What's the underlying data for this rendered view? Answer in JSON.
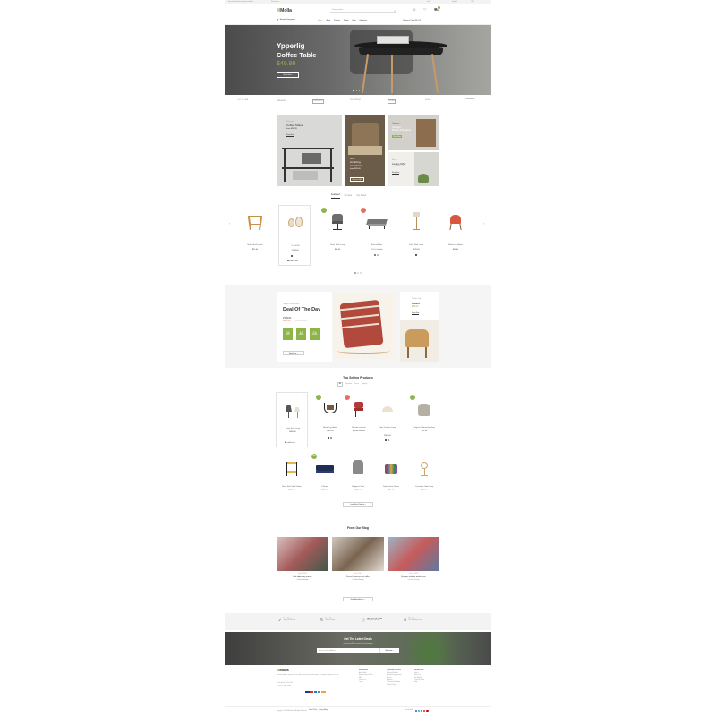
{
  "topbar": {
    "left_text": "Special collection already available.",
    "left_link": "Read more ...",
    "links": [
      "Links",
      "English",
      "USD"
    ]
  },
  "header": {
    "logo_prefix": "M",
    "logo_main": "Molla",
    "search_placeholder": "Search product ...",
    "icons": [
      "user-icon",
      "heart-icon",
      "cart-icon"
    ],
    "cart_count": "2",
    "cart_label": "Shopping Cart",
    "cart_total": "$164.00"
  },
  "nav": {
    "categories_label": "Browse Categories",
    "items": [
      "Home",
      "Shop",
      "Product",
      "Pages",
      "Blog",
      "Elements"
    ],
    "active_index": 0,
    "promo": "Clearance Up to 30% Off"
  },
  "hero": {
    "title_line1": "Ypperlig",
    "title_line2": "Coffee Table",
    "price": "$49.99",
    "button": "Shop Now",
    "dots": 3,
    "active_dot": 0
  },
  "brands": [
    "OLIVEIRA",
    "Sheaves",
    "BRENNER",
    "mockup",
    "ATLAS",
    "NORD",
    "THEBRIDE"
  ],
  "banners": [
    {
      "kicker": "Clearance",
      "title_line1": "Coffee Tables",
      "title_line2": "from $99.99",
      "button": "Shop Now"
    },
    {
      "kicker": "New in",
      "title_line1": "Amazing",
      "title_line2": "Armchairs",
      "subtitle": "from $39.00",
      "button": "Discover Now"
    },
    {
      "kicker": "Clearance",
      "title_line1": "Storage",
      "title_line2": "Boxes & Baskets",
      "button": "Shop Now"
    },
    {
      "kicker": "New in",
      "title_line1": "Lamps Offer",
      "title_line2": "up to 30% off",
      "button": "Shop Now"
    }
  ],
  "tabs": {
    "items": [
      "Featured",
      "On Sale",
      "Top Rated"
    ],
    "active_index": 0
  },
  "featured": {
    "products": [
      {
        "name": "Butler Stool Ladder",
        "price": "$25.00",
        "badge": "",
        "icon": "stool-icon"
      },
      {
        "name": "Octo 4240",
        "price": "$746.00",
        "badge": "",
        "icon": "pendant-lamp-icon",
        "action": "add to cart"
      },
      {
        "name": "Petite Table Lamp",
        "price": "$99.00",
        "badge": "Top",
        "icon": "chair-icon"
      },
      {
        "name": "Sofa with Arm",
        "price": "$33.00",
        "old_price": "$40.00",
        "badge": "Sale",
        "icon": "sofa-icon"
      },
      {
        "name": "Petite Table Lamp",
        "price": "$675.00",
        "badge": "",
        "icon": "floor-lamp-icon"
      },
      {
        "name": "Madra Log Holder",
        "price": "$40.00",
        "badge": "",
        "icon": "armchair-icon"
      }
    ],
    "dots": 3
  },
  "deal": {
    "kicker": "Today's Deal and more",
    "title": "Deal Of The Day",
    "product": "POÄNG",
    "price": "$249.00",
    "old_price": "Was $339.00",
    "countdown": [
      {
        "value": "06",
        "label": "hours"
      },
      {
        "value": "16",
        "label": "minutes"
      },
      {
        "value": "24",
        "label": "seconds"
      }
    ],
    "button": "Shop Now",
    "side_kicker": "The Best Choice",
    "side_title": "AGEN",
    "side_price": "$49.00",
    "side_button": "Shop Now"
  },
  "topselling": {
    "title": "Top Selling Products",
    "tabs": [
      "All",
      "Furniture",
      "Decor",
      "Lighting"
    ],
    "active_tab": 0,
    "row1": [
      {
        "name": "Petite Table Lamp",
        "price": "$400.00",
        "badge": "",
        "icon": "table-lamp-icon",
        "action": "add to cart"
      },
      {
        "name": "Madra Log Holder",
        "price": "$401.00",
        "badge": "Top",
        "icon": "log-holder-icon"
      },
      {
        "name": "Wooden armchair",
        "price": "$90.00",
        "old_price": "$100.00",
        "badge": "Sale",
        "icon": "dining-chair-icon"
      },
      {
        "name": "Lime Cordless Lamp",
        "price": "$351.00",
        "badge": "",
        "icon": "pendant-lamp-icon"
      },
      {
        "name": "Original Outdoor Beanbag",
        "price": "$49.00",
        "badge": "New",
        "icon": "beanbag-icon"
      }
    ],
    "row2": [
      {
        "name": "Black Side Table/Trolley",
        "price": "$230.00",
        "badge": "",
        "icon": "trolley-icon"
      },
      {
        "name": "2-Seater",
        "price": "$299.00",
        "badge": "New",
        "icon": "loveseat-icon"
      },
      {
        "name": "Wingback Chair",
        "price": "$220.00",
        "badge": "",
        "icon": "wingback-icon"
      },
      {
        "name": "Garden Seat Pattern",
        "price": "$90.00",
        "badge": "",
        "icon": "pouf-icon"
      },
      {
        "name": "Carronade Table Lamp",
        "price": "$250.00",
        "badge": "",
        "icon": "desk-lamp-icon"
      }
    ],
    "load_more": "Load More Products"
  },
  "blog": {
    "title": "From Our Blog",
    "posts": [
      {
        "date": "Nov 22, 2018",
        "title": "Sed adipiscing ornare.",
        "link": "Continue Reading"
      },
      {
        "date": "Dec 12, 2018",
        "title": "Fusce lacinia arcu et nulla.",
        "link": "Continue Reading"
      },
      {
        "date": "Dec 19, 2018",
        "title": "Quisque volutpat mattis eros.",
        "link": "Continue Reading"
      }
    ],
    "button": "View More Articles"
  },
  "features": [
    {
      "title": "Free Shipping",
      "text": "Orders $50 or more",
      "icon": "rocket-icon"
    },
    {
      "title": "Free Returns",
      "text": "Within 30 days",
      "icon": "rotate-icon"
    },
    {
      "title": "Get 20% Off 1 Item",
      "text": "When you sign up",
      "icon": "info-icon"
    },
    {
      "title": "We Support",
      "text": "24/7 amazing services",
      "icon": "lifebuoy-icon"
    }
  ],
  "newsletter": {
    "title": "Get The Latest Deals",
    "subtitle": "and receive $20 coupon for first shopping",
    "placeholder": "Enter your Email Address",
    "button": "Subscribe"
  },
  "footer": {
    "logo_prefix": "M",
    "logo_main": "Molla",
    "about": "Praesent dapibus, neque id cursus ucibus, tortor neque egestas augue, eu vulputate magna eros eu erat.",
    "phone_label": "Got Question? Call us 24/7",
    "phone": "+0123 456 789",
    "columns": [
      {
        "title": "Information",
        "links": [
          "About Molla",
          "How to shop on Molla",
          "FAQ",
          "Contact us",
          "Log in"
        ]
      },
      {
        "title": "Customer Service",
        "links": [
          "Payment Methods",
          "Money-back guarantee!",
          "Returns",
          "Shipping",
          "Terms and conditions",
          "Privacy Policy"
        ]
      },
      {
        "title": "My Account",
        "links": [
          "Sign In",
          "View Cart",
          "My Wishlist",
          "Track My Order",
          "Help"
        ]
      }
    ],
    "payments": [
      "VISA",
      "MC",
      "PP",
      "AE",
      "DISC"
    ],
    "copyright": "Copyright © 2019 Molla Store. All Rights Reserved.",
    "terms": "Terms Of Use",
    "privacy": "Privacy Policy",
    "social_label": "Social Media",
    "social_icons": [
      "facebook-icon",
      "twitter-icon",
      "instagram-icon",
      "youtube-icon",
      "pinterest-icon"
    ]
  },
  "colors": {
    "accent": "#8cb449",
    "sale": "#e86e61",
    "dark": "#333333",
    "bg_soft": "#f5f5f5"
  }
}
